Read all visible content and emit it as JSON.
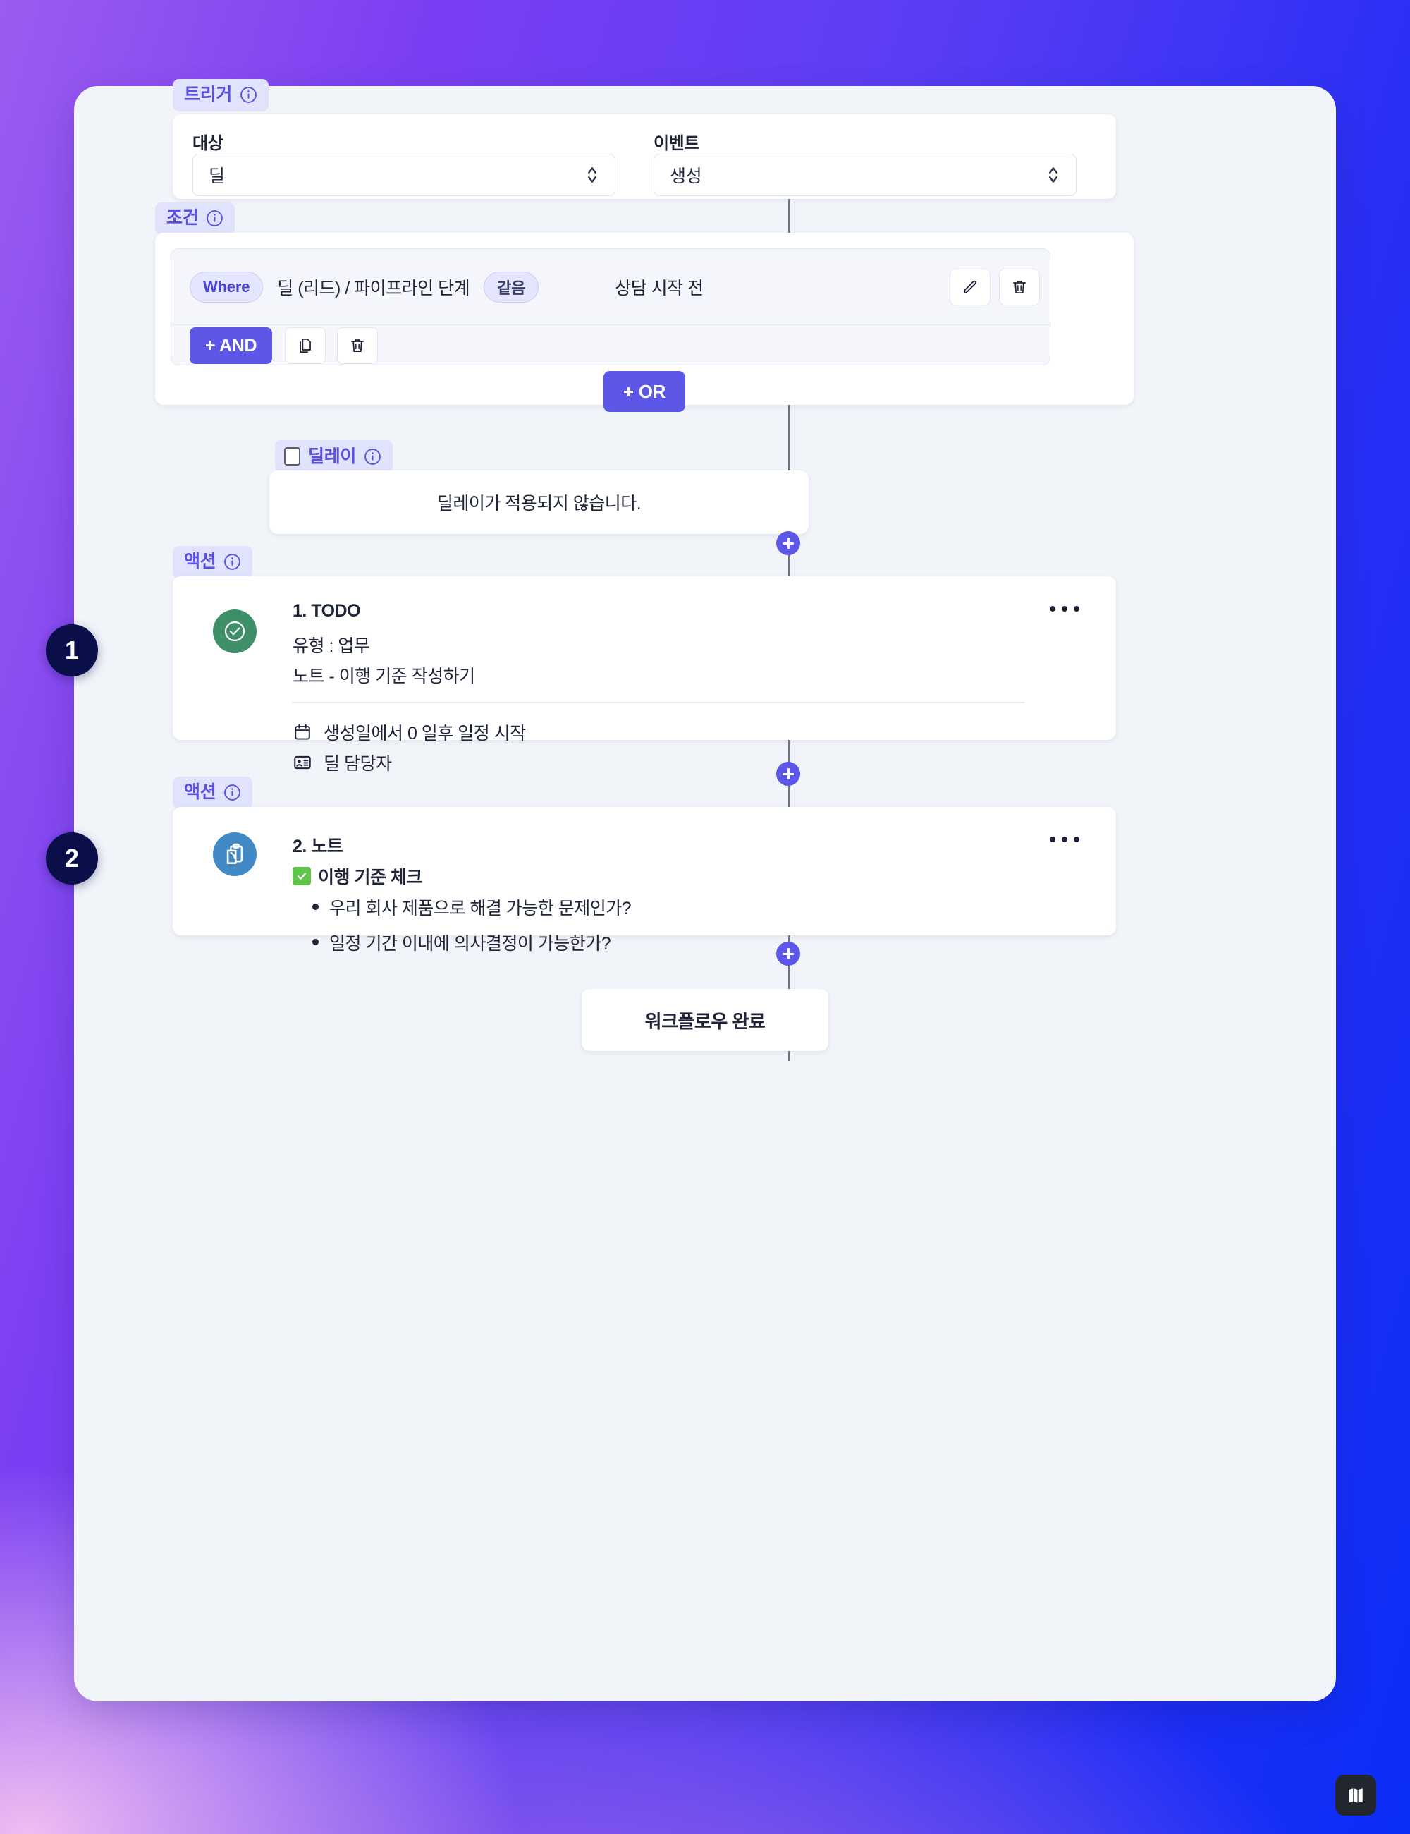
{
  "trigger": {
    "section_label": "트리거",
    "target_label": "대상",
    "target_value": "딜",
    "event_label": "이벤트",
    "event_value": "생성"
  },
  "condition": {
    "section_label": "조건",
    "where_chip": "Where",
    "field_text": "딜 (리드) / 파이프라인 단계",
    "operator_chip": "같음",
    "value_text": "상담 시작 전",
    "edit_icon": "pencil-icon",
    "delete_icon": "trash-icon",
    "add_and_label": "+ AND",
    "copy_icon": "copy-icon",
    "group_delete_icon": "trash-icon",
    "add_or_label": "+ OR"
  },
  "delay": {
    "section_label": "딜레이",
    "checkbox_checked": false,
    "message": "딜레이가 적용되지 않습니다."
  },
  "actions": [
    {
      "section_label": "액션",
      "badge": "1",
      "icon": "check-circle-icon",
      "icon_color": "#3f8f68",
      "title": "1. TODO",
      "type_line": "유형 : 업무",
      "note_line": "노트 - 이행 기준 작성하기",
      "meta": [
        {
          "icon": "calendar-icon",
          "text": "생성일에서 0 일후 일정 시작"
        },
        {
          "icon": "contact-card-icon",
          "text": "딜 담당자"
        }
      ],
      "menu_icon": "more-horizontal-icon"
    },
    {
      "section_label": "액션",
      "badge": "2",
      "icon": "clipboard-icon",
      "icon_color": "#4189c4",
      "title": "2. 노트",
      "note_heading": "이행 기준 체크",
      "note_items": [
        "우리 회사 제품으로 해결 가능한 문제인가?",
        "일정 기간 이내에 의사결정이 가능한가?"
      ],
      "menu_icon": "more-horizontal-icon"
    }
  ],
  "finish": {
    "label": "워크플로우 완료"
  },
  "widget": {
    "icon": "book-icon"
  },
  "colors": {
    "accent": "#5d57e8",
    "pill_bg": "#e0e3fb",
    "pill_text": "#5a4fe0",
    "panel_bg": "#f1f4f9",
    "badge_bg": "#0a0f49",
    "green": "#3f8f68",
    "blue": "#4189c4"
  }
}
